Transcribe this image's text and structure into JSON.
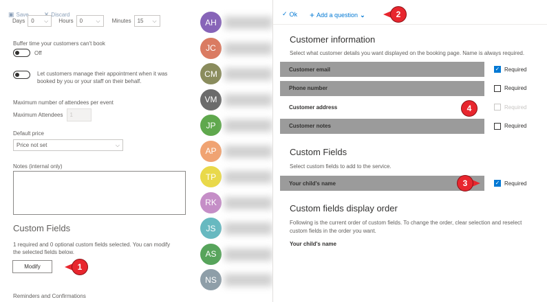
{
  "left": {
    "toolbar": {
      "save_label": "Save",
      "discard_label": "Discard"
    },
    "duration": {
      "days_label": "Days",
      "days_value": "0",
      "hours_label": "Hours",
      "hours_value": "0",
      "minutes_label": "Minutes",
      "minutes_value": "15"
    },
    "buffer": {
      "label": "Buffer time your customers can't book",
      "toggle_state": "Off"
    },
    "manage": {
      "text_line1": "Let customers manage their appointment when it was",
      "text_line2": "booked by you or your staff on their behalf."
    },
    "attendees": {
      "section_label": "Maximum number of attendees per event",
      "field_label": "Maximum Attendees",
      "value": "1"
    },
    "price": {
      "label": "Default price",
      "value": "Price not set"
    },
    "notes": {
      "label": "Notes (internal only)"
    },
    "custom_fields": {
      "heading": "Custom Fields",
      "summary_line1": "1 required and 0 optional custom fields selected. You can modify",
      "summary_line2": "the selected fields below.",
      "modify_label": "Modify"
    },
    "reminders": {
      "heading": "Reminders and Confirmations"
    }
  },
  "avatars": [
    {
      "initials": "AH",
      "color": "#8764b8"
    },
    {
      "initials": "JC",
      "color": "#da7b62"
    },
    {
      "initials": "CM",
      "color": "#8a8c5d"
    },
    {
      "initials": "VM",
      "color": "#6b6b6b"
    },
    {
      "initials": "JP",
      "color": "#5fa84d"
    },
    {
      "initials": "AP",
      "color": "#f0a372"
    },
    {
      "initials": "TP",
      "color": "#e9d94a"
    },
    {
      "initials": "RK",
      "color": "#c58ec7"
    },
    {
      "initials": "JS",
      "color": "#67b9c0"
    },
    {
      "initials": "AS",
      "color": "#57a45b"
    },
    {
      "initials": "NS",
      "color": "#8e9ea8"
    }
  ],
  "right": {
    "toolbar": {
      "ok_label": "Ok",
      "add_question_label": "Add a question"
    },
    "customer_info": {
      "heading": "Customer information",
      "description": "Select what customer details you want displayed on the booking page. Name is always required.",
      "rows": [
        {
          "label": "Customer email",
          "checked": true,
          "required_label": "Required",
          "disabled": false,
          "highlighted": true
        },
        {
          "label": "Phone number",
          "checked": false,
          "required_label": "Required",
          "disabled": false,
          "highlighted": true
        },
        {
          "label": "Customer address",
          "checked": false,
          "required_label": "Required",
          "disabled": true,
          "highlighted": false
        },
        {
          "label": "Customer notes",
          "checked": false,
          "required_label": "Required",
          "disabled": false,
          "highlighted": true
        }
      ]
    },
    "custom_fields": {
      "heading": "Custom Fields",
      "description": "Select custom fields to add to the service.",
      "rows": [
        {
          "label": "Your child's name",
          "checked": true,
          "required_label": "Required",
          "disabled": false,
          "highlighted": true
        }
      ]
    },
    "display_order": {
      "heading": "Custom fields display order",
      "description_line1": "Following is the current order of custom fields. To change the order, clear selection and reselect",
      "description_line2": "custom fields in the order you want.",
      "items": [
        "Your child's name"
      ]
    }
  },
  "markers": [
    "1",
    "2",
    "3",
    "4"
  ],
  "colors": {
    "accent": "#0078d4",
    "marker": "#e8262e",
    "highlight_bar": "#9b9b9b"
  }
}
